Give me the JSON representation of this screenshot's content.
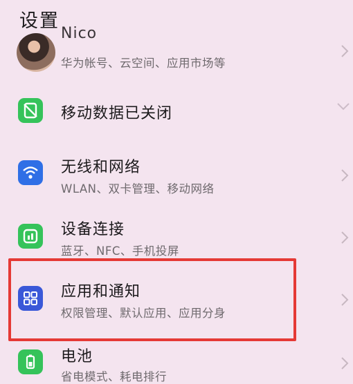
{
  "header": {
    "title": "设置"
  },
  "account": {
    "name": "Nico",
    "subtitle": "华为帐号、云空间、应用市场等"
  },
  "mobile_data": {
    "label": "移动数据已关闭"
  },
  "items": [
    {
      "label": "无线和网络",
      "subtitle": "WLAN、双卡管理、移动网络",
      "icon": "wifi-icon",
      "color": "#2f6fe6"
    },
    {
      "label": "设备连接",
      "subtitle": "蓝牙、NFC、手机投屏",
      "icon": "device-connection-icon",
      "color": "#35c35a"
    },
    {
      "label": "应用和通知",
      "subtitle": "权限管理、默认应用、应用分身",
      "icon": "apps-icon",
      "color": "#3a58d8"
    },
    {
      "label": "电池",
      "subtitle": "省电模式、耗电排行",
      "icon": "battery-icon",
      "color": "#35c35a"
    }
  ],
  "highlight_color": "#e53935"
}
